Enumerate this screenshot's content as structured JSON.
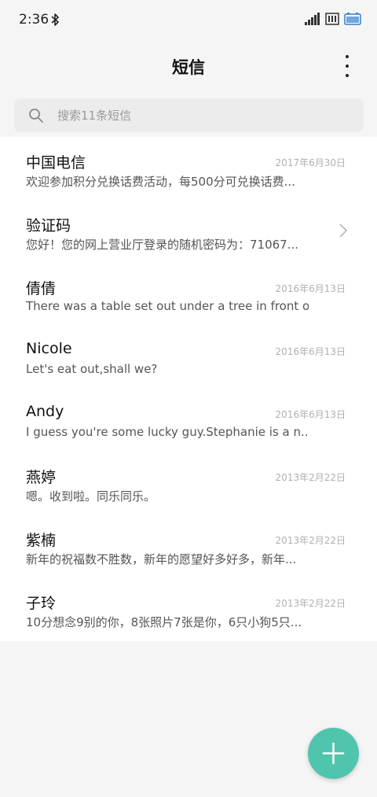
{
  "status_bar": {
    "time": "2:36",
    "icons": [
      "bluetooth-icon",
      "signal-icon",
      "sim-icon",
      "battery-icon"
    ]
  },
  "header": {
    "title": "短信",
    "more_icon": "more-vertical-icon"
  },
  "search": {
    "placeholder": "搜索11条短信",
    "value": "",
    "icon": "search-icon"
  },
  "messages": [
    {
      "sender": "中国电信",
      "date": "2017年6月30日",
      "preview": "欢迎参加积分兑换话费活动，每500分可兑换话费..."
    },
    {
      "sender": "验证码",
      "date": "",
      "preview": "您好！您的网上营业厅登录的随机密码为：71067..."
    },
    {
      "sender": "倩倩",
      "date": "2016年6月13日",
      "preview": "There was a table set out under a tree in front o..."
    },
    {
      "sender": "Nicole",
      "date": "2016年6月13日",
      "preview": "Let's eat out,shall we?"
    },
    {
      "sender": "Andy",
      "date": "2016年6月13日",
      "preview": "I guess you're some lucky guy.Stephanie is a n..."
    },
    {
      "sender": "燕婷",
      "date": "2013年2月22日",
      "preview": "嗯。收到啦。同乐同乐。"
    },
    {
      "sender": "紫楠",
      "date": "2013年2月22日",
      "preview": "新年的祝福数不胜数，新年的愿望好多好多，新年..."
    },
    {
      "sender": "子玲",
      "date": "2013年2月22日",
      "preview": "10分想念9别的你，8张照片7张是你，6只小狗5只..."
    }
  ],
  "colors": {
    "background": "#f5f5f5",
    "list_background": "#ffffff",
    "fab": "#4fc5ad",
    "date_text": "#b0b0b0"
  },
  "fab": {
    "icon": "plus-icon"
  }
}
